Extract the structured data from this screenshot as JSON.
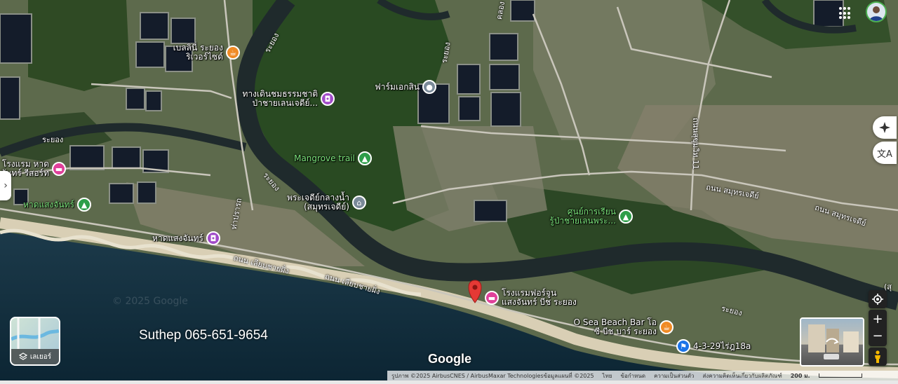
{
  "map": {
    "pois": [
      {
        "name": "poi-hotel-belle-rayong",
        "label": "เบลลินี่ ระยอง\nริเวอร์ไซด์",
        "color": "#f08a24",
        "icon": "cup-icon",
        "labelClass": "",
        "labelSide": "left"
      },
      {
        "name": "poi-mangrove-nature-trail",
        "label": "ทางเดินชมธรรมชาติ\nป่าชายเลนเจดีย์...",
        "color": "#a14bc9",
        "icon": "camera-icon",
        "labelClass": "",
        "labelSide": "left"
      },
      {
        "name": "poi-farm-ekasin",
        "label": "ฟาร์มเอกสิน",
        "color": "#7a8a99",
        "icon": "pin-icon",
        "labelClass": "",
        "labelSide": "left"
      },
      {
        "name": "poi-mangrove-trail",
        "label": "Mangrove trail",
        "color": "#2e9e49",
        "icon": "tree-icon",
        "labelClass": "green",
        "labelSide": "left"
      },
      {
        "name": "poi-chedi-klang-nam",
        "label": "พระเจดีย์กลางน้ำ\n(สมุทรเจดีย์)",
        "color": "#7a8a99",
        "icon": "temple-icon",
        "labelClass": "",
        "labelSide": "left"
      },
      {
        "name": "poi-mangrove-learning-center",
        "label": "ศูนย์การเรียน\nรู้ป่าชายเลนพระ...",
        "color": "#2e9e49",
        "icon": "tree-icon",
        "labelClass": "green",
        "labelSide": "left"
      },
      {
        "name": "poi-hotel-haad-saeng-chan",
        "label": "โรงแรม หาด\nจันทร์ รีสอร์ท",
        "color": "#e0409a",
        "icon": "bed-icon",
        "labelClass": "",
        "labelSide": "left"
      },
      {
        "name": "poi-haad-saeng-chan-green",
        "label": "หาดแสงจันทร์",
        "color": "#2e9e49",
        "icon": "tree-icon",
        "labelClass": "green",
        "labelSide": "left"
      },
      {
        "name": "poi-haad-saeng-chan-beach",
        "label": "หาดแสงจันทร์",
        "color": "#a14bc9",
        "icon": "camera-icon",
        "labelClass": "",
        "labelSide": "left"
      },
      {
        "name": "poi-hotel-forgun",
        "label": "โรงแรมฟอร์จูน\nแสงจันทร์ บีช ระยอง",
        "color": "#e0409a",
        "icon": "bed-icon",
        "labelClass": "",
        "labelSide": "right"
      },
      {
        "name": "poi-o-sea-beach-bar",
        "label": "O Sea Beach Bar โอ\nซี บีช บาร์ ระยอง",
        "color": "#f08a24",
        "icon": "cup-icon",
        "labelClass": "",
        "labelSide": "left"
      },
      {
        "name": "poi-location-4-3-29",
        "label": "4-3-29ไร่ฎ18a",
        "color": "#1a73e8",
        "icon": "flag-icon",
        "labelClass": "",
        "labelSide": "right"
      }
    ],
    "roads": [
      {
        "name": "road-label-rayong-1",
        "text": "ระยอง"
      },
      {
        "name": "road-label-rayong-2",
        "text": "ระยอง"
      },
      {
        "name": "road-label-rayong-3",
        "text": "ระยอง"
      },
      {
        "name": "road-label-rayong-4",
        "text": "ระยอง"
      },
      {
        "name": "road-label-rayong-5",
        "text": "ระยอง"
      },
      {
        "name": "road-label-sukhumvit-11",
        "text": "ถนนสุขุมวิท 11"
      },
      {
        "name": "road-label-samut-chedi-1",
        "text": "ถนน สมุทรเจดีย์"
      },
      {
        "name": "road-label-samut-chedi-2",
        "text": "ถนน สมุทรเจดีย์"
      },
      {
        "name": "road-label-liab-chai-fang-1",
        "text": "ถนน เลียบชายฝั่ง"
      },
      {
        "name": "road-label-liab-chai-fang-2",
        "text": "ถนน เลียบชายฝั่ง"
      },
      {
        "name": "road-label-tha-prachum",
        "text": "ท่าปรารถ"
      },
      {
        "name": "road-label-klong",
        "text": "คลอง"
      },
      {
        "name": "road-label-su",
        "text": "(สุ"
      }
    ],
    "watermark": "© 2025 Google",
    "phone_overlay": "Suthep 065-651-9654",
    "google_logo": "Google",
    "pin_color": "#e53935"
  },
  "controls": {
    "layers_label": "เลเยอร์",
    "zoom_in": "+",
    "zoom_out": "−",
    "expand": "›"
  },
  "attribution": {
    "imagery": "รูปภาพ ©2025 AirbusCNES / AirbusMaxar Technologiesข้อมูลแผนที่ ©2025",
    "language": "ไทย",
    "terms": "ข้อกำหนด",
    "privacy": "ความเป็นส่วนตัว",
    "feedback": "ส่งความคิดเห็นเกี่ยวกับผลิตภัณฑ์",
    "scale": "200 ม."
  }
}
